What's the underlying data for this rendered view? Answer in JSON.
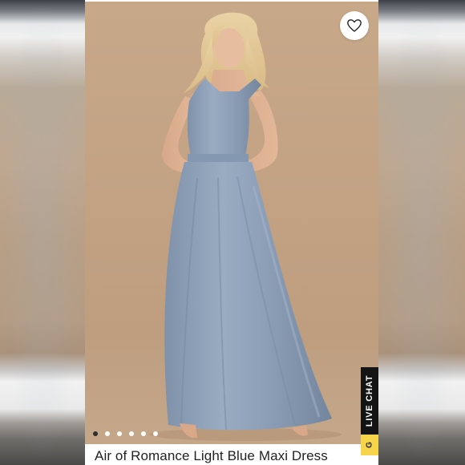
{
  "product": {
    "title": "Air of Romance Light Blue Maxi Dress"
  },
  "gallery": {
    "image_count": 6,
    "active_index": 0
  },
  "favorite": {
    "icon": "heart-icon"
  },
  "live_chat": {
    "label": "LIVE CHAT",
    "tail_label": "G"
  },
  "colors": {
    "dress": "#8fa1b8",
    "backdrop": "#c2a283",
    "chat_bg": "#141414",
    "chat_tail": "#f6d54a"
  }
}
